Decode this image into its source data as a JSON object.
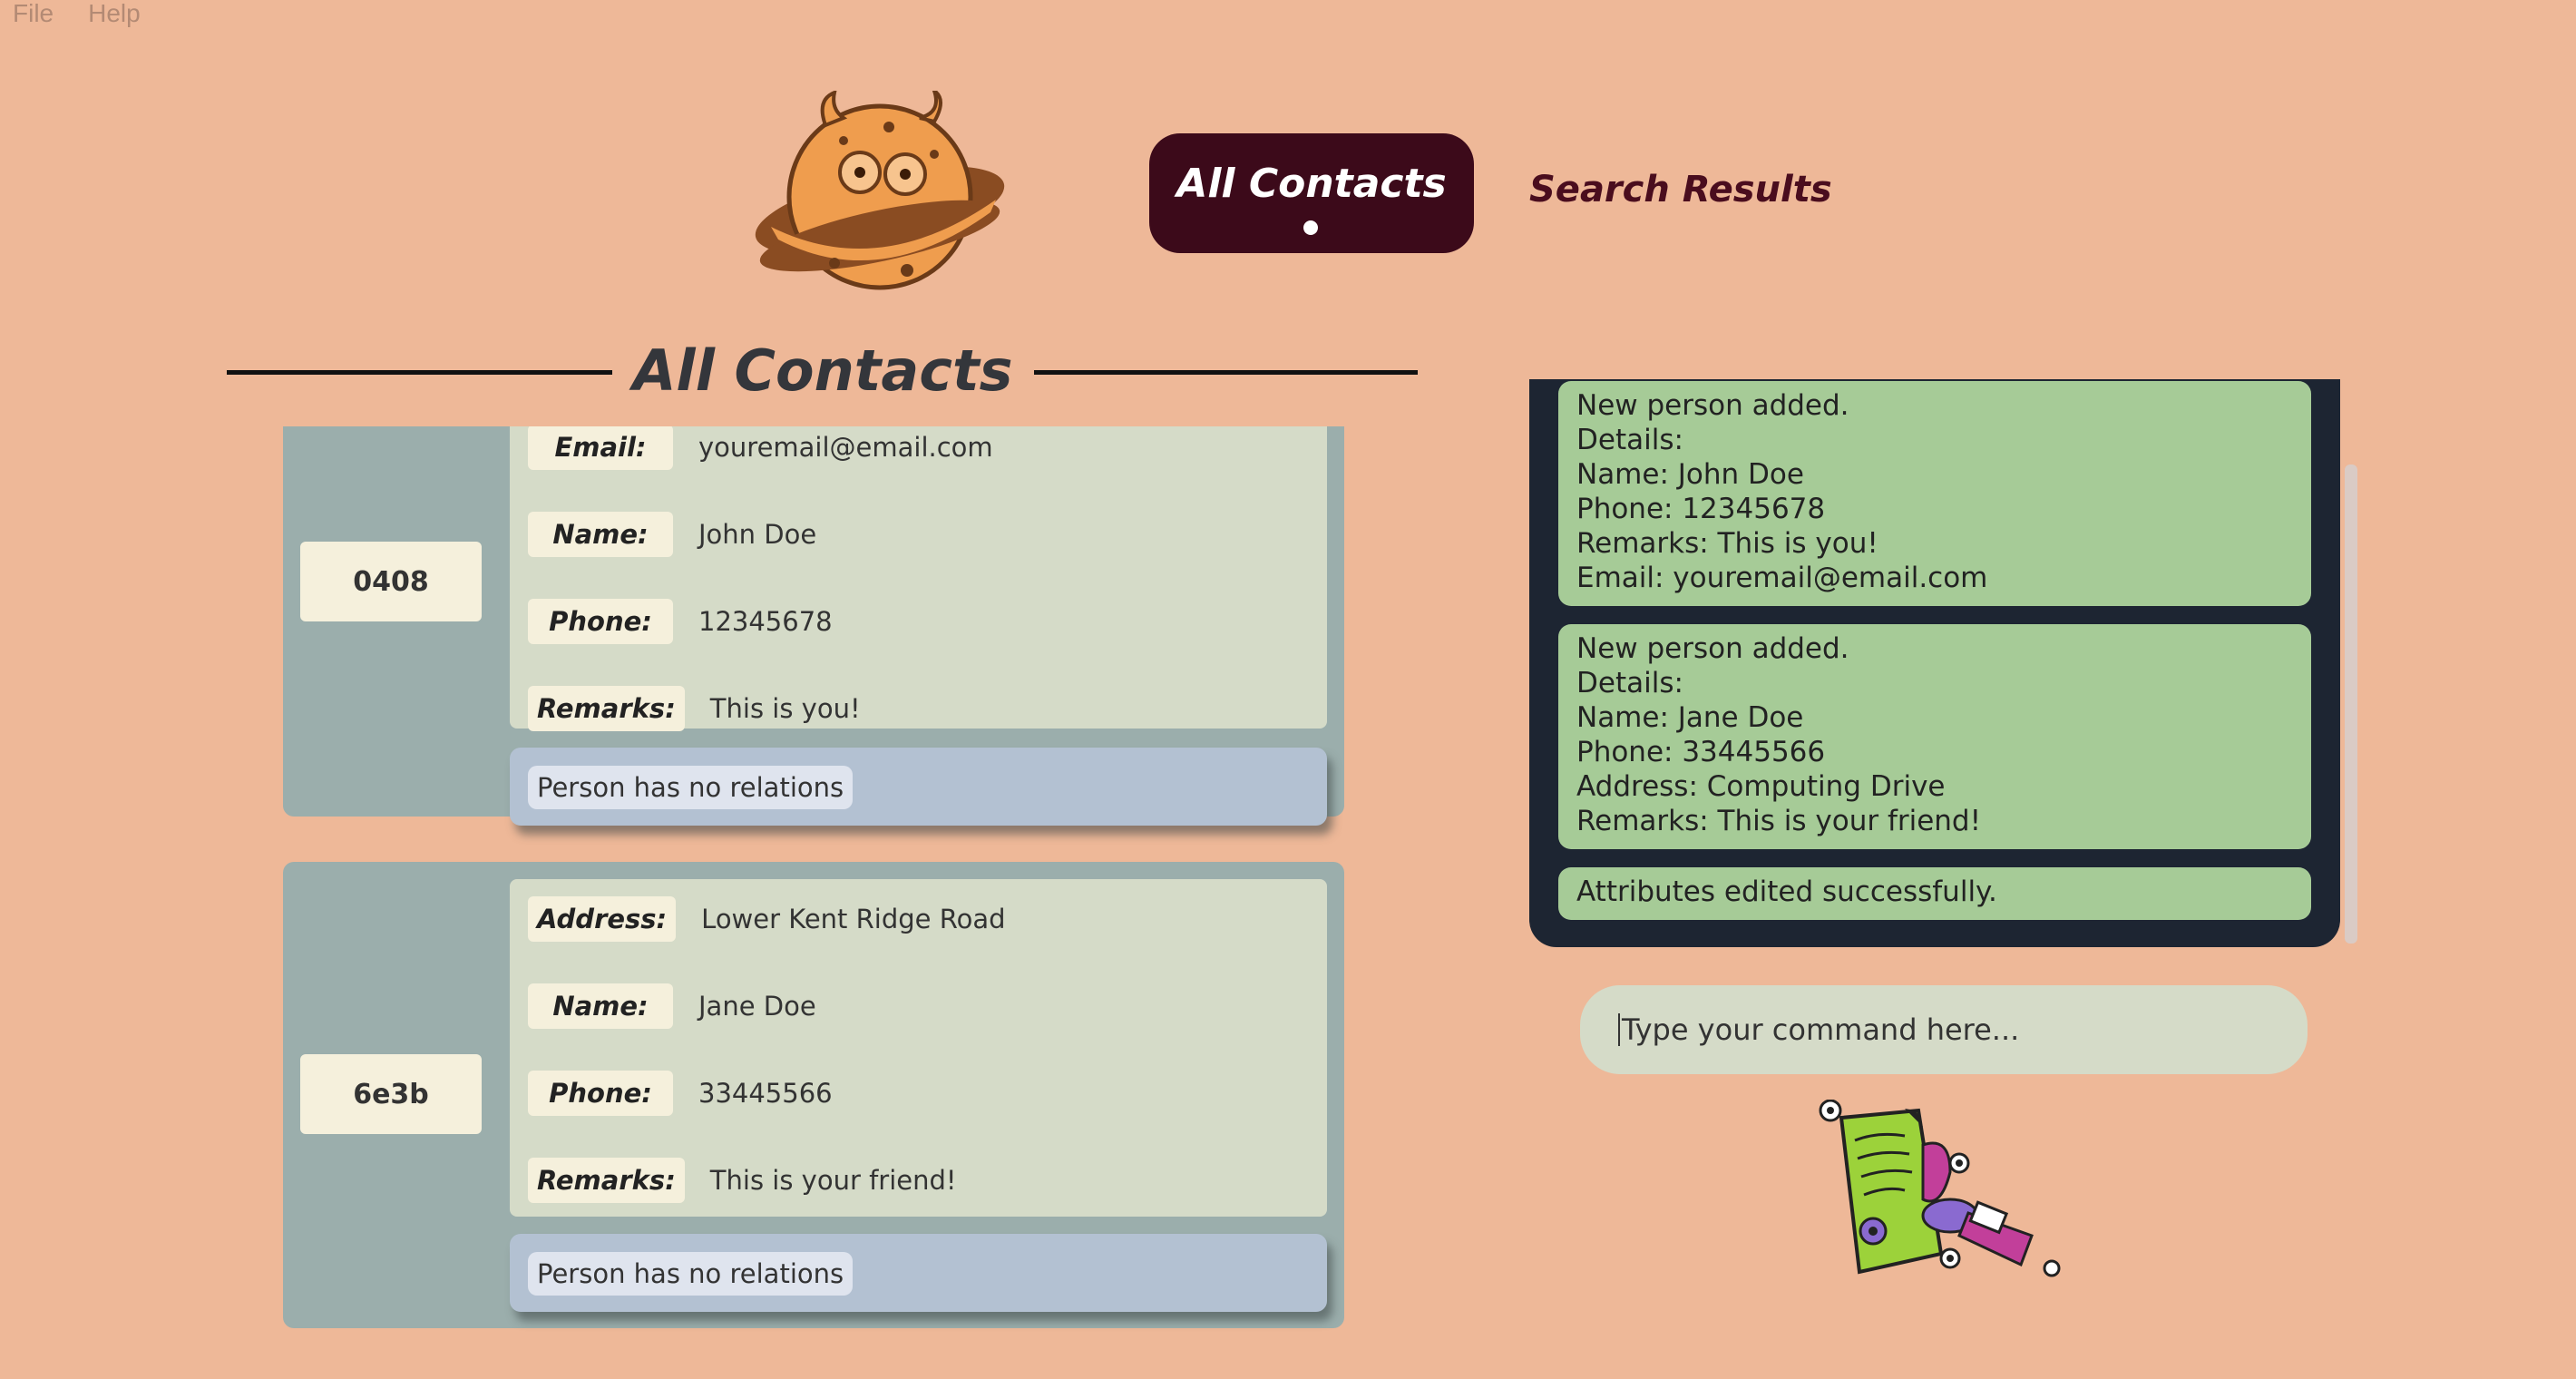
{
  "menu": {
    "file": "File",
    "help": "Help"
  },
  "logo": {
    "icon": "cookie-monster-planet-icon"
  },
  "tabs": {
    "all_contacts": "All Contacts",
    "search_results": "Search Results"
  },
  "section": {
    "title": "All Contacts"
  },
  "contacts": [
    {
      "id": "0408",
      "fields": [
        {
          "label": "Email:",
          "value": "youremail@email.com"
        },
        {
          "label": "Name:",
          "value": "John Doe"
        },
        {
          "label": "Phone:",
          "value": "12345678"
        },
        {
          "label": "Remarks:",
          "value": "This is you!"
        }
      ],
      "relations": "Person has no relations"
    },
    {
      "id": "6e3b",
      "fields": [
        {
          "label": "Address:",
          "value": "Lower Kent Ridge Road"
        },
        {
          "label": "Name:",
          "value": "Jane Doe"
        },
        {
          "label": "Phone:",
          "value": "33445566"
        },
        {
          "label": "Remarks:",
          "value": "This is your friend!"
        }
      ],
      "relations": "Person has no relations"
    }
  ],
  "results": [
    "New person added.\nDetails:\nName: John Doe\nPhone: 12345678\nRemarks: This is you!\nEmail: youremail@email.com",
    "New person added.\nDetails:\nName: Jane Doe\nPhone: 33445566\nAddress: Computing Drive\nRemarks: This is your friend!",
    "Attributes edited successfully."
  ],
  "command": {
    "placeholder": "Type your command here..."
  },
  "colors": {
    "background": "#eeb898",
    "tab_active": "#3c0a1a",
    "card": "#9baeac",
    "details": "#d5dbc8",
    "relations": "#b3c1d2",
    "result_panel": "#1d2532",
    "result_message": "#a6cb97"
  }
}
